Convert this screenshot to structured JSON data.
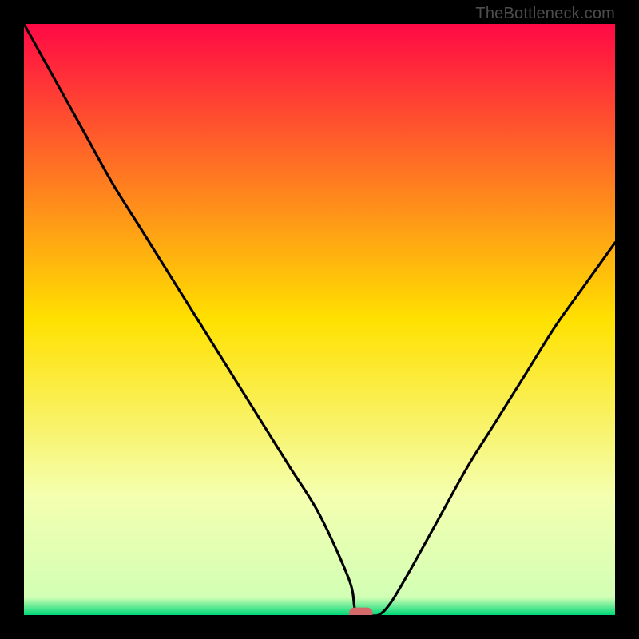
{
  "watermark": "TheBottleneck.com",
  "colors": {
    "top": "#ff0945",
    "mid": "#ffe100",
    "low": "#f4ffb0",
    "base": "#00d878",
    "curve": "#000000",
    "marker": "#d46a6a",
    "border": "#000000"
  },
  "chart_data": {
    "type": "line",
    "title": "",
    "xlabel": "",
    "ylabel": "",
    "xlim": [
      0,
      100
    ],
    "ylim": [
      0,
      100
    ],
    "series": [
      {
        "name": "curve",
        "x": [
          0,
          5,
          10,
          15,
          20,
          25,
          30,
          35,
          40,
          45,
          50,
          55,
          56,
          57,
          58,
          60,
          62,
          65,
          70,
          75,
          80,
          85,
          90,
          95,
          100
        ],
        "y": [
          100,
          91,
          82,
          73,
          65,
          57,
          49,
          41,
          33,
          25,
          17,
          6,
          1,
          0,
          0,
          0,
          2,
          7,
          16,
          25,
          33,
          41,
          49,
          56,
          63
        ]
      }
    ],
    "marker": {
      "x": 57,
      "y": 0,
      "w": 4,
      "h": 2
    },
    "gradient_stops": [
      {
        "offset": 0.0,
        "color": "#ff0945"
      },
      {
        "offset": 0.5,
        "color": "#ffe100"
      },
      {
        "offset": 0.8,
        "color": "#f4ffb0"
      },
      {
        "offset": 0.97,
        "color": "#d2ffb5"
      },
      {
        "offset": 1.0,
        "color": "#00d878"
      }
    ]
  }
}
